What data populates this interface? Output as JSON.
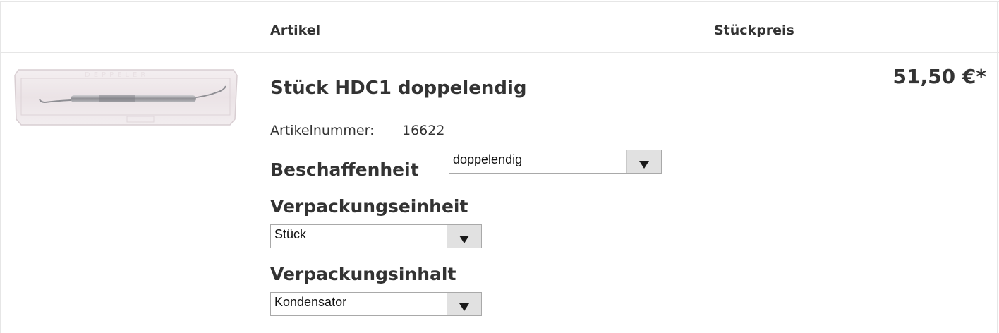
{
  "table": {
    "headers": {
      "article": "Artikel",
      "unit_price": "Stückpreis"
    }
  },
  "product": {
    "title": "Stück HDC1 doppelendig",
    "article_number_label": "Artikelnummer:",
    "article_number": "16622",
    "image_icon": "instrument-case-image",
    "price": "51,50 €*",
    "options": [
      {
        "label": "Beschaffenheit",
        "selected": "doppelendig"
      },
      {
        "label": "Verpackungseinheit",
        "selected": "Stück"
      },
      {
        "label": "Verpackungsinhalt",
        "selected": "Kondensator"
      }
    ]
  },
  "colors": {
    "border": "#e6e6e6",
    "text": "#333333",
    "select_button": "#e1e1e1"
  }
}
